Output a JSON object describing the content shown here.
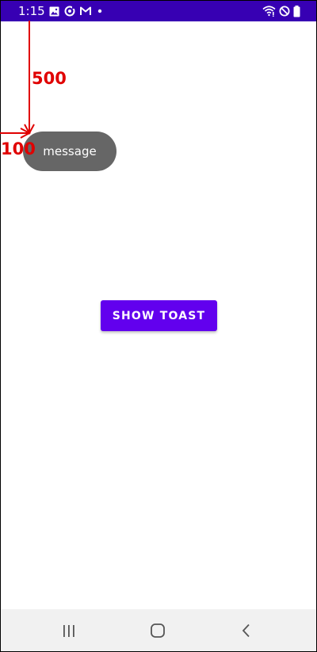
{
  "status_bar": {
    "time": "1:15",
    "background": "#3700b3",
    "left_icons": [
      "gallery-icon",
      "sync-icon",
      "gmail-icon",
      "notification-dot-icon"
    ],
    "right_icons": [
      "wifi-icon",
      "do-not-disturb-icon",
      "battery-icon"
    ]
  },
  "toast": {
    "message": "message",
    "background": "#666666"
  },
  "main": {
    "show_toast_label": "SHOW TOAST",
    "button_color": "#6200ee"
  },
  "annotations": {
    "y_offset_label": "500",
    "x_offset_label": "100",
    "color": "#e00000"
  },
  "nav_bar": {
    "buttons": [
      "recents-icon",
      "home-icon",
      "back-icon"
    ]
  }
}
